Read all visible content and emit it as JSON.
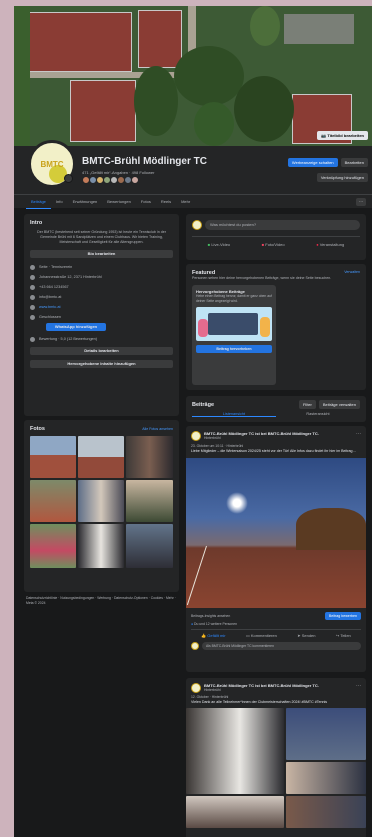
{
  "cover": {
    "edit_label": "Titelbild bearbeiten"
  },
  "profile": {
    "avatar_text": "BMTC",
    "name": "BMTC-Brühl Mödlinger TC",
    "stats": "471 „Gefällt mir“-Angaben · 498 Follower",
    "buttons": {
      "promote": "Werbeanzeige schalten",
      "edit": "Bearbeiten",
      "manage": "Verknüpfung hinzufügen"
    }
  },
  "tabs": [
    "Beiträge",
    "Info",
    "Erwähnungen",
    "Bewertungen",
    "Fotos",
    "Reels",
    "Mehr"
  ],
  "tab_more": "···",
  "intro": {
    "title": "Intro",
    "bio": "Der BMTC (bestehend seit seiner Gründung 1953) ist heute ein Tennisclub in der Gemeinde Brühl mit 6 Sandplätzen und einem Clubhaus. Wir bieten Training, Meisterschaft und Geselligkeit für alle Altersgruppen.",
    "edit_bio": "Bio bearbeiten",
    "rows": [
      {
        "icon": "info-icon",
        "text": "Seite · Tennisverein"
      },
      {
        "icon": "location-icon",
        "text": "Johannesstraße 12, 2371 Hinterbrühl"
      },
      {
        "icon": "phone-icon",
        "text": "+43 664 1234567"
      },
      {
        "icon": "mail-icon",
        "text": "info@bmtc.at"
      },
      {
        "icon": "link-icon",
        "text": "www.bmtc.at"
      },
      {
        "icon": "clock-icon",
        "text": "Geschlossen"
      }
    ],
    "whatsapp_label": "WhatsApp hinzufügen",
    "rating": "Bewertung · 5,0 (12 Bewertungen)",
    "edit_details": "Details bearbeiten",
    "add_featured": "Hervorgehobene Inhalte hinzufügen"
  },
  "photos": {
    "title": "Fotos",
    "see_all": "Alle Fotos ansehen"
  },
  "footer": "Datenschutzrichtlinie · Nutzungsbedingungen · Werbung · Datenschutz-Optionen · Cookies · Mehr · Meta © 2024",
  "composer": {
    "placeholder": "Was möchtest du posten?",
    "live": "Live-Video",
    "photo": "Foto/Video",
    "event": "Veranstaltung"
  },
  "featured": {
    "title": "Featured",
    "manage": "Verwalten",
    "subtitle": "Personen sehen hier deine hervorgehobenen Beiträge, wenn sie deine Seite besuchen.",
    "card_title": "Hervorgehobene Beiträge",
    "card_text": "Hebe einen Beitrag hervor, damit er ganz oben auf deiner Seite angezeigt wird.",
    "card_button": "Beitrag hervorheben"
  },
  "posts_header": {
    "title": "Beiträge",
    "filter": "Filter",
    "manage": "Beiträge verwalten",
    "list_view": "Listenansicht",
    "grid_view": "Rasteransicht"
  },
  "post1": {
    "author": "BMTC-Brühl Mödlinger TC ist bei BMTC-Brühl Mödlinger TC.",
    "meta": "Hinterbrühl",
    "date": "23. Oktober um 10:11 · Hinterbrühl",
    "text": "Liebe Mitglieder – die Wintersaison 2024/25 steht vor der Tür! Alle Infos dazu findet ihr hier im Beitrag…",
    "insights": "Beitrags-Insights ansehen",
    "boost": "Beitrag bewerben",
    "reactions": "Du und 12 weitere Personen",
    "like": "Gefällt mir",
    "comment": "Kommentieren",
    "send": "Senden",
    "share": "Teilen",
    "comment_placeholder": "Als BMTC-Brühl Mödlinger TC kommentieren"
  },
  "post2": {
    "author": "BMTC-Brühl Mödlinger TC ist bei BMTC-Brühl Mödlinger TC.",
    "meta": "Hinterbrühl",
    "date": "12. Oktober · Hinterbrühl",
    "text": "Vielen Dank an alle Teilnehmer*innen der Clubmeisterschaften 2024! #BMTC #Tennis"
  },
  "colors": {
    "accent": "#2d88ff",
    "bg": "#18191a",
    "card": "#242526"
  }
}
